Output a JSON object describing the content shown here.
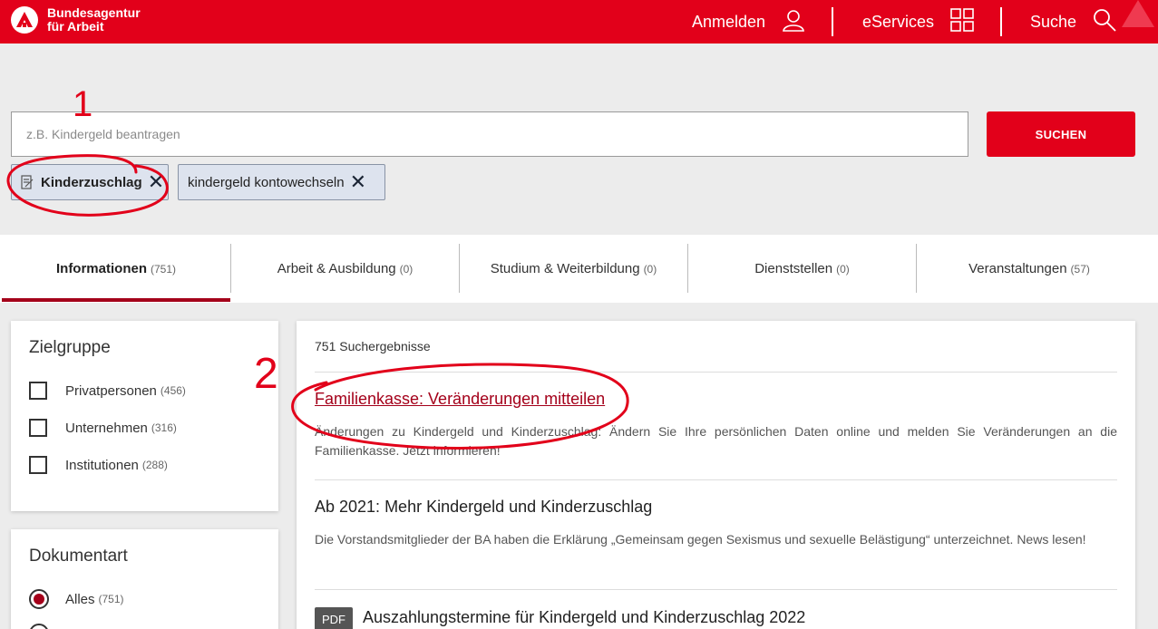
{
  "header": {
    "logo_line1": "Bundesagentur",
    "logo_line2": "für Arbeit",
    "login_label": "Anmelden",
    "eservices_label": "eServices",
    "search_label": "Suche",
    "brand_color": "#e2001a"
  },
  "search": {
    "placeholder": "z.B. Kindergeld beantragen",
    "value": "",
    "button_label": "SUCHEN",
    "chips": [
      {
        "label": "Kinderzuschlag",
        "icon": "document-edit-icon"
      },
      {
        "label": "kindergeld kontowechseln"
      }
    ]
  },
  "tabs": [
    {
      "label": "Informationen",
      "count": "(751)",
      "active": true
    },
    {
      "label": "Arbeit & Ausbildung",
      "count": "(0)"
    },
    {
      "label": "Studium & Weiterbildung",
      "count": "(0)"
    },
    {
      "label": "Dienststellen",
      "count": "(0)"
    },
    {
      "label": "Veranstaltungen",
      "count": "(57)"
    }
  ],
  "filters": {
    "zielgruppe": {
      "title": "Zielgruppe",
      "items": [
        {
          "label": "Privatpersonen",
          "count": "(456)"
        },
        {
          "label": "Unternehmen",
          "count": "(316)"
        },
        {
          "label": "Institutionen",
          "count": "(288)"
        }
      ]
    },
    "dokumentart": {
      "title": "Dokumentart",
      "items": [
        {
          "label": "Alles",
          "count": "(751)",
          "selected": true
        }
      ]
    }
  },
  "results": {
    "count_label": "751 Suchergebnisse",
    "items": [
      {
        "title": "Familienkasse: Veränderungen mitteilen",
        "snippet": "Änderungen zu Kindergeld und Kinderzuschlag: Ändern Sie Ihre persönlichen Daten online und melden Sie Veränderungen an die Familienkasse. Jetzt informieren!"
      },
      {
        "title": "Ab 2021: Mehr Kindergeld und Kinderzuschlag",
        "snippet": "Die Vorstandsmitglieder der BA haben die Erklärung „Gemeinsam gegen Sexismus und sexuelle Belästigung“ unterzeichnet. News lesen!"
      },
      {
        "badge": "PDF",
        "title": "Auszahlungstermine für Kindergeld und Kinderzuschlag 2022"
      }
    ]
  },
  "annotations": {
    "mark1": "1",
    "mark2": "2",
    "color": "#e2001a"
  }
}
